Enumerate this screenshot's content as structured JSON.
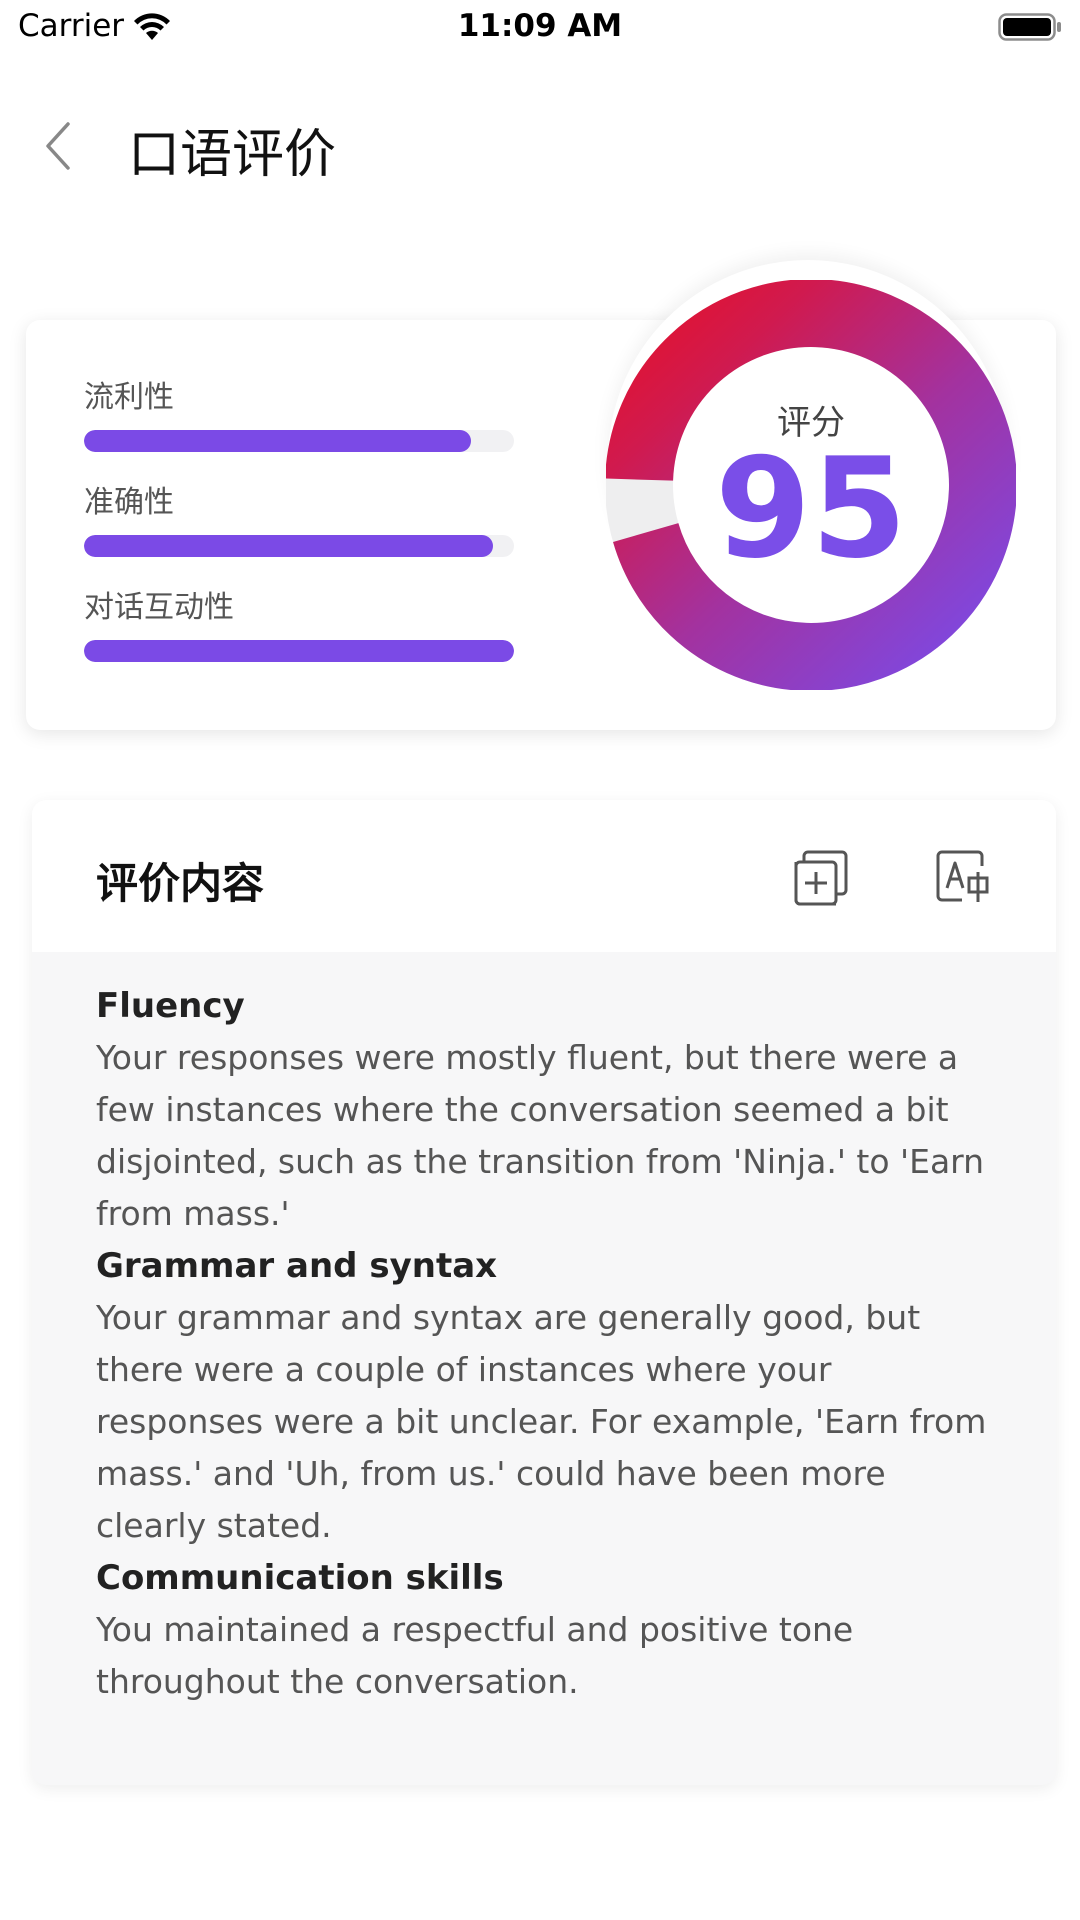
{
  "status_bar": {
    "carrier": "Carrier",
    "time": "11:09 AM"
  },
  "header": {
    "title": "口语评价",
    "back_icon": "chevron-left-icon"
  },
  "score_card": {
    "metrics": [
      {
        "label": "流利性",
        "value": 0.9
      },
      {
        "label": "准确性",
        "value": 0.95
      },
      {
        "label": "对话互动性",
        "value": 1.0
      }
    ],
    "score_label": "评分",
    "score_value": "95",
    "score_fraction": 0.95
  },
  "content_card": {
    "title": "评价内容",
    "icons": [
      "copy-add-icon",
      "translate-icon"
    ],
    "sections": [
      {
        "title": "Fluency",
        "text": "Your responses were mostly fluent, but there were a few instances where the conversation seemed a bit disjointed, such as the transition from 'Ninja.' to 'Earn from mass.'"
      },
      {
        "title": "Grammar and syntax",
        "text": "Your grammar and syntax are generally good, but there were a couple of instances where your responses were a bit unclear. For example, 'Earn from mass.' and 'Uh, from us.' could have been more clearly stated."
      },
      {
        "title": "Communication skills",
        "text": "You maintained a respectful and positive tone throughout the conversation."
      }
    ]
  },
  "colors": {
    "accent_purple": "#7b4ae6",
    "accent_red": "#e3122e",
    "score_text": "#7a4ee8"
  }
}
